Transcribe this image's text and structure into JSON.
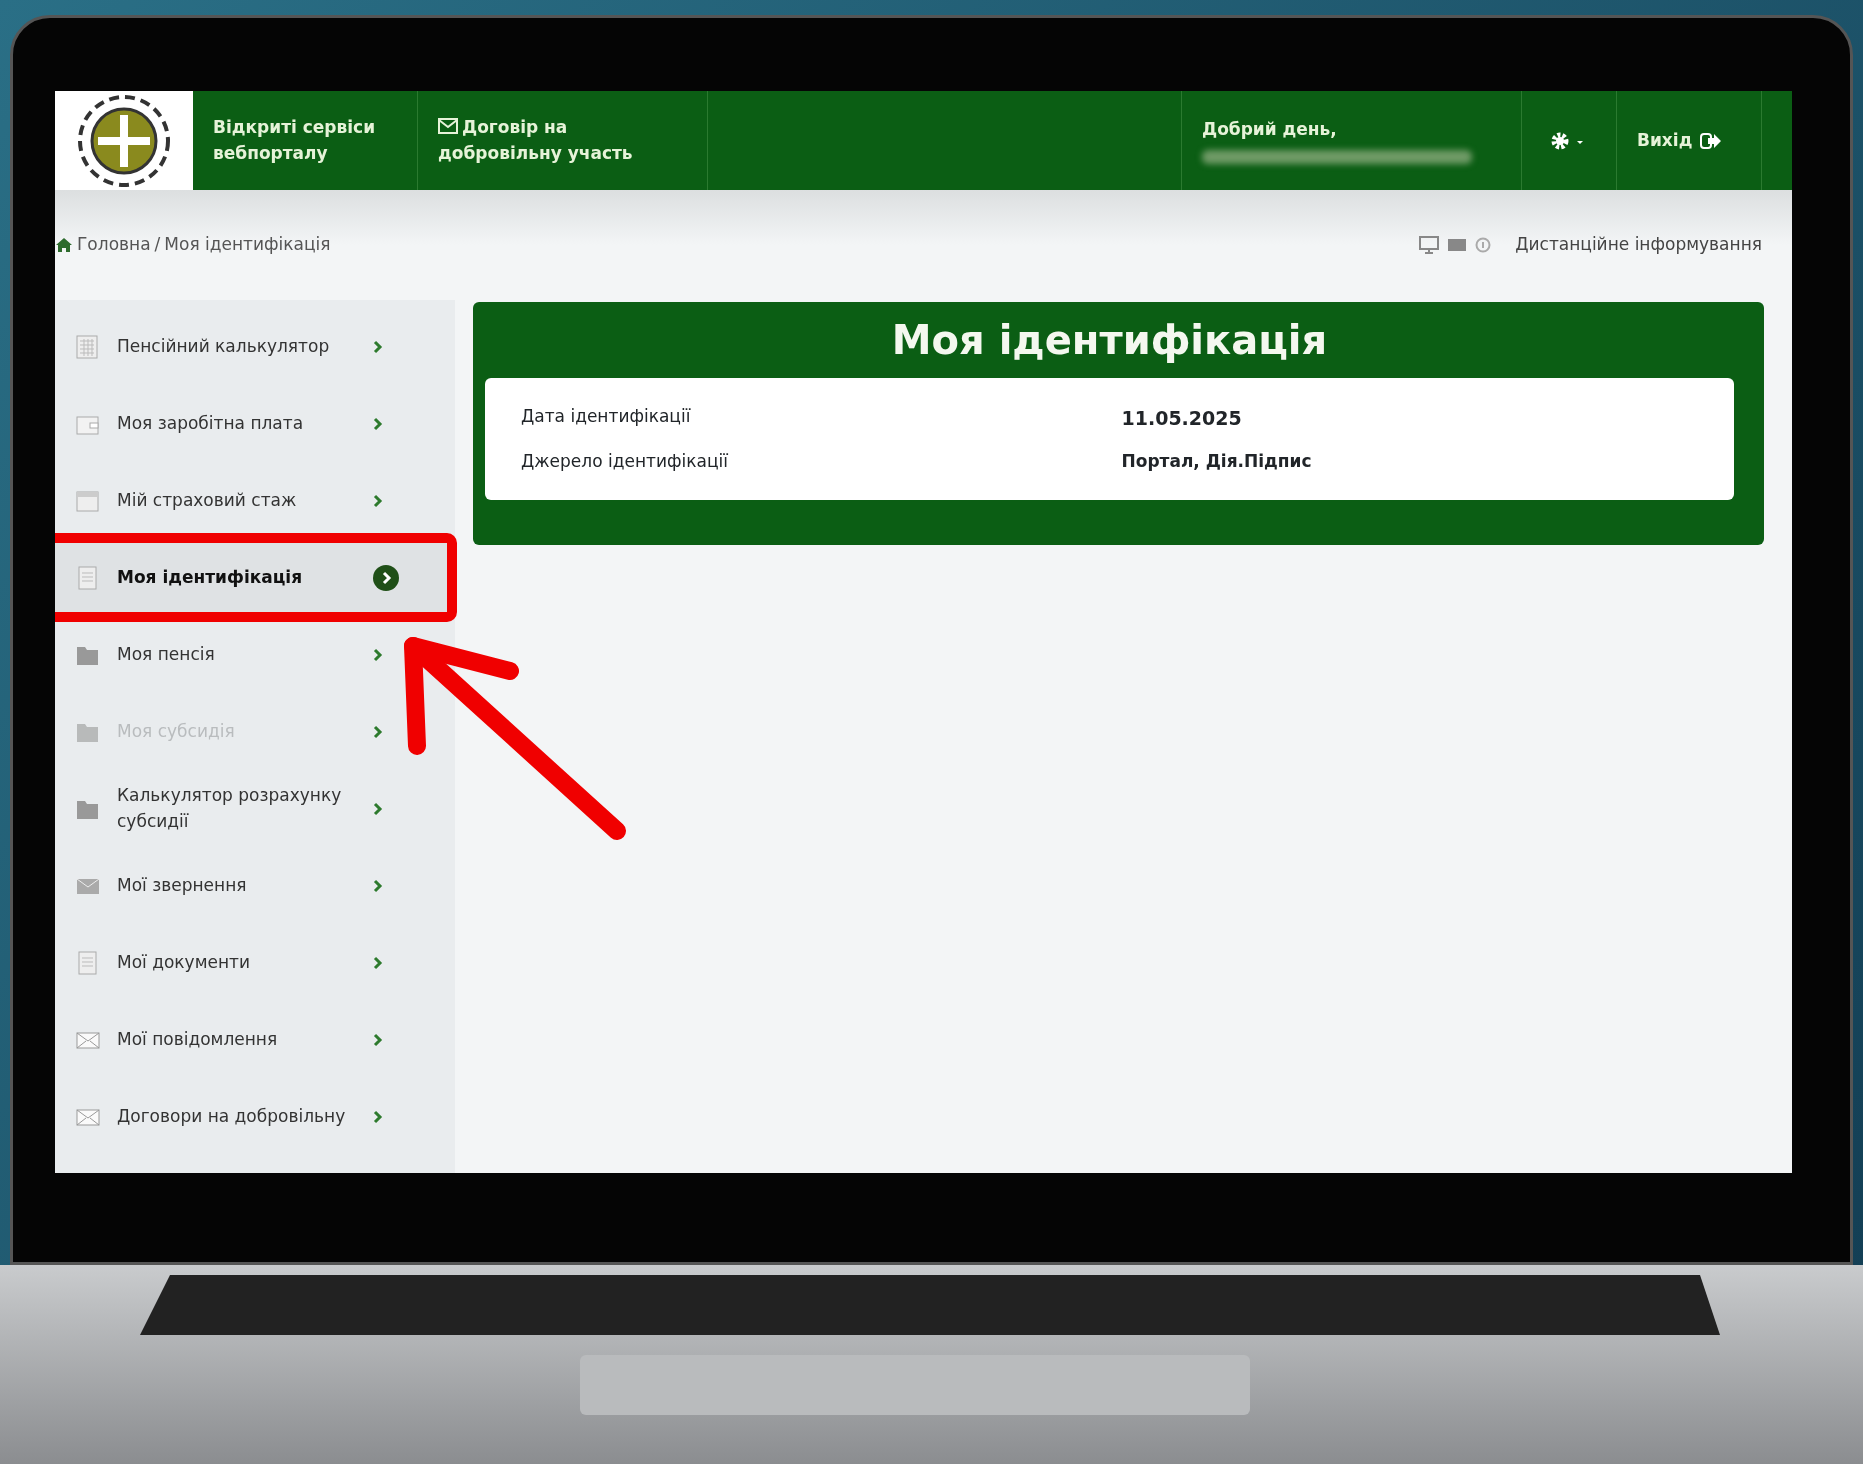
{
  "navbar": {
    "brand": "Відкриті сервіси вебпорталу",
    "contract_link": "Договір на добровільну участь",
    "greeting": "Добрий день,",
    "logout": "Вихід"
  },
  "breadcrumb": {
    "items": [
      "Головна",
      "Моя ідентифікація"
    ],
    "separator": "/"
  },
  "remote_info": "Дистанційне інформування",
  "sidebar": {
    "items": [
      {
        "label": "Пенсійний калькулятор",
        "selected": false,
        "disabled": false
      },
      {
        "label": "Моя заробітна плата",
        "selected": false,
        "disabled": false
      },
      {
        "label": "Мій страховий стаж",
        "selected": false,
        "disabled": false
      },
      {
        "label": "Моя ідентифікація",
        "selected": true,
        "disabled": false
      },
      {
        "label": "Моя пенсія",
        "selected": false,
        "disabled": false
      },
      {
        "label": "Моя субсидія",
        "selected": false,
        "disabled": true
      },
      {
        "label": "Калькулятор розрахунку субсидії",
        "selected": false,
        "disabled": false
      },
      {
        "label": "Мої звернення",
        "selected": false,
        "disabled": false
      },
      {
        "label": "Мої документи",
        "selected": false,
        "disabled": false
      },
      {
        "label": "Мої повідомлення",
        "selected": false,
        "disabled": false
      },
      {
        "label": "Договори на добровільну",
        "selected": false,
        "disabled": false
      }
    ]
  },
  "panel": {
    "title": "Моя ідентифікація",
    "rows": [
      {
        "label": "Дата ідентифікації",
        "value": "11.05.2025"
      },
      {
        "label": "Джерело ідентифікації",
        "value": "Портал, Дія.Підпис"
      }
    ]
  }
}
